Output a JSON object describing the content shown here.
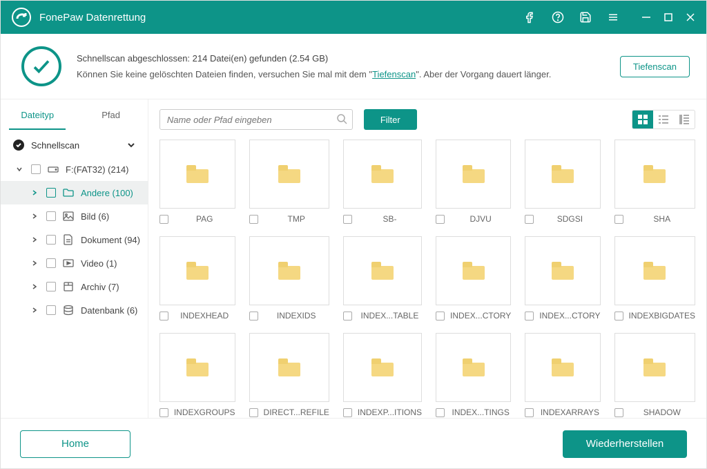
{
  "app": {
    "title": "FonePaw Datenrettung"
  },
  "banner": {
    "line1": "Schnellscan abgeschlossen: 214 Datei(en) gefunden (2.54 GB)",
    "line2a": "Können Sie keine gelöschten Dateien finden, versuchen Sie mal mit dem \"",
    "deep_link": "Tiefenscan",
    "line2b": "\". Aber der Vorgang dauert länger.",
    "deepscan_button": "Tiefenscan"
  },
  "sidebar": {
    "tabs": {
      "filetype": "Dateityp",
      "path": "Pfad"
    },
    "root": "Schnellscan",
    "drive": "F:(FAT32) (214)",
    "categories": [
      {
        "label": "Andere (100)",
        "icon": "folder",
        "selected": true
      },
      {
        "label": "Bild (6)",
        "icon": "image",
        "selected": false
      },
      {
        "label": "Dokument (94)",
        "icon": "document",
        "selected": false
      },
      {
        "label": "Video (1)",
        "icon": "video",
        "selected": false
      },
      {
        "label": "Archiv (7)",
        "icon": "archive",
        "selected": false
      },
      {
        "label": "Datenbank (6)",
        "icon": "database",
        "selected": false
      }
    ]
  },
  "toolbar": {
    "search_placeholder": "Name oder Pfad eingeben",
    "filter": "Filter"
  },
  "items": [
    {
      "name": "PAG"
    },
    {
      "name": "TMP"
    },
    {
      "name": "SB-"
    },
    {
      "name": "DJVU"
    },
    {
      "name": "SDGSI"
    },
    {
      "name": "SHA"
    },
    {
      "name": "INDEXHEAD"
    },
    {
      "name": "INDEXIDS"
    },
    {
      "name": "INDEX...TABLE"
    },
    {
      "name": "INDEX...CTORY"
    },
    {
      "name": "INDEX...CTORY"
    },
    {
      "name": "INDEXBIGDATES"
    },
    {
      "name": "INDEXGROUPS"
    },
    {
      "name": "DIRECT...REFILE"
    },
    {
      "name": "INDEXP...ITIONS"
    },
    {
      "name": "INDEX...TINGS"
    },
    {
      "name": "INDEXARRAYS"
    },
    {
      "name": "SHADOW"
    }
  ],
  "footer": {
    "home": "Home",
    "recover": "Wiederherstellen"
  }
}
